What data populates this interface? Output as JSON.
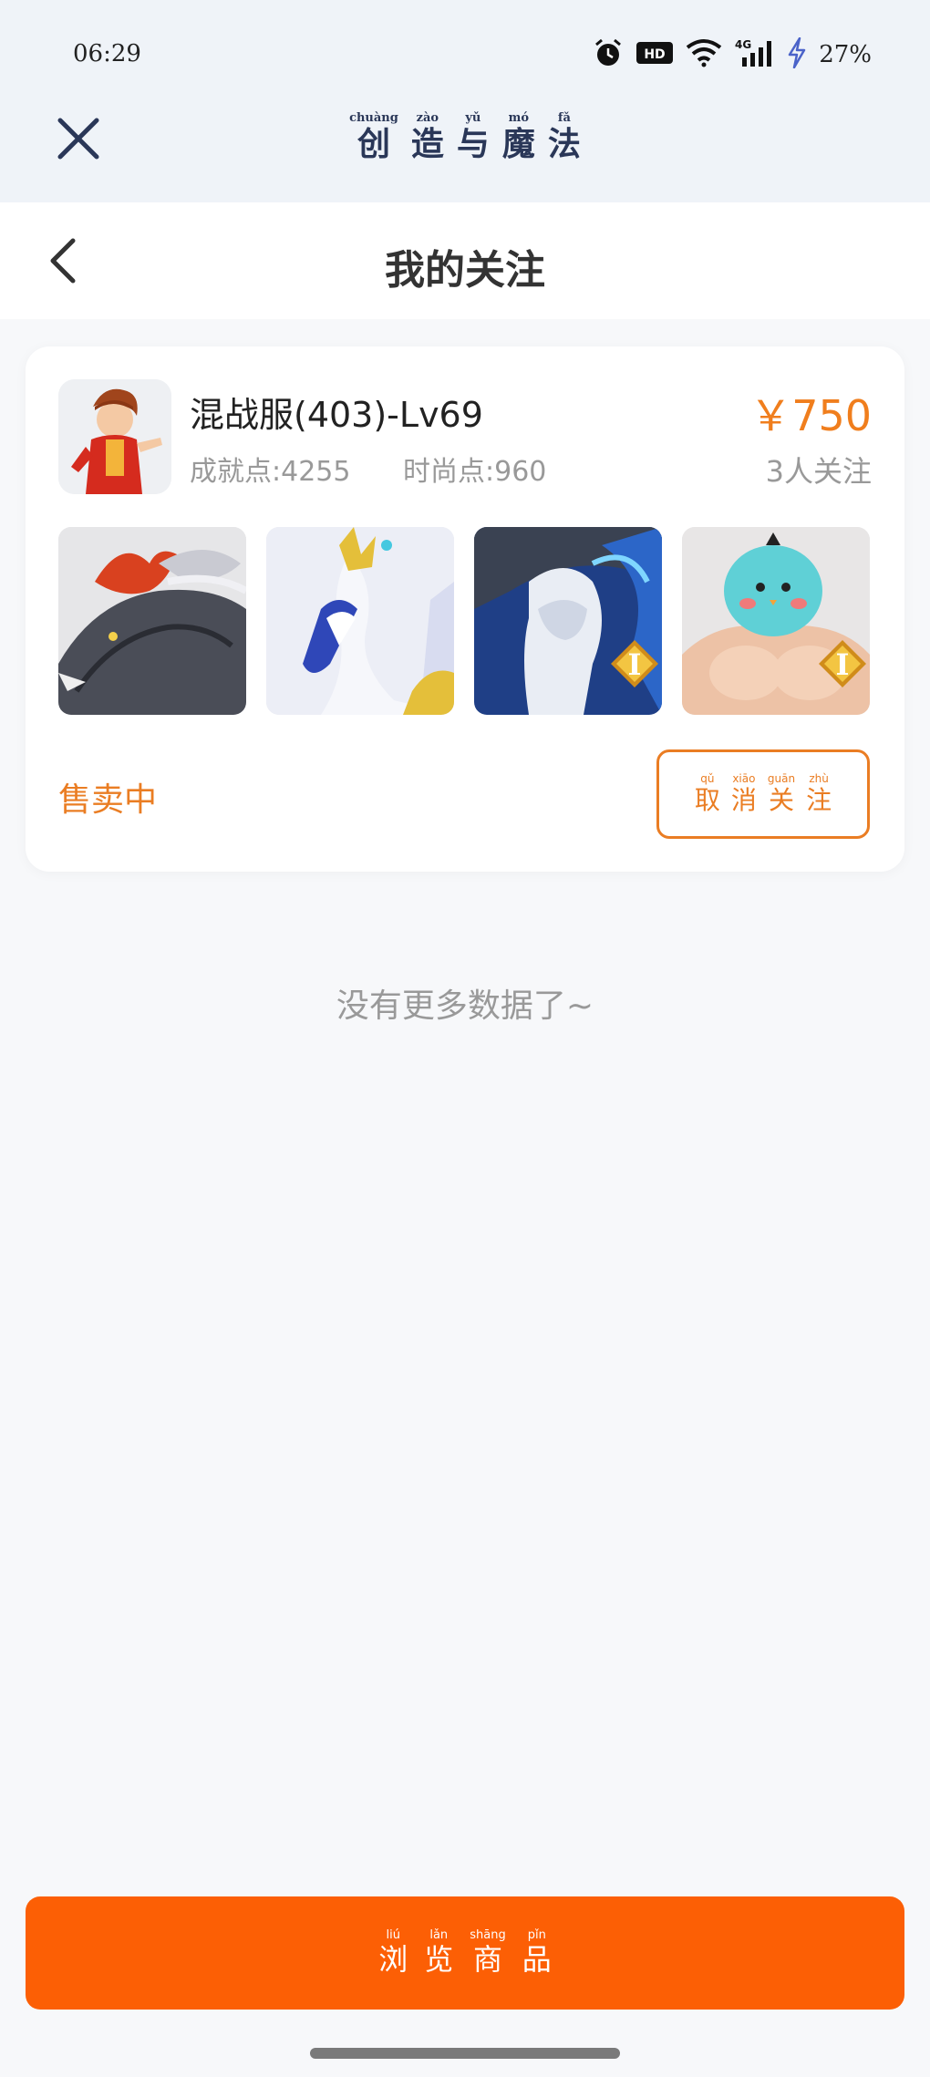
{
  "status_bar": {
    "time": "06:29",
    "battery": "27%",
    "icons": [
      "alarm-icon",
      "hd-icon",
      "wifi-icon",
      "signal-4g-icon",
      "charging-icon"
    ]
  },
  "app_bar": {
    "title_chars": [
      {
        "py": "chuàng",
        "hz": "创"
      },
      {
        "py": "zào",
        "hz": "造"
      },
      {
        "py": "yǔ",
        "hz": "与"
      },
      {
        "py": "mó",
        "hz": "魔"
      },
      {
        "py": "fǎ",
        "hz": "法"
      }
    ]
  },
  "nav": {
    "title": "我的关注"
  },
  "listing": {
    "server_name": "混战服(403)-Lv69",
    "achievement": "成就点:4255",
    "fashion": "时尚点:960",
    "price": "￥750",
    "followers": "3人关注",
    "status": "售卖中",
    "thumb_badge": "I",
    "unfollow_chars": [
      {
        "py": "qǔ",
        "hz": "取"
      },
      {
        "py": "xiāo",
        "hz": "消"
      },
      {
        "py": "guān",
        "hz": "关"
      },
      {
        "py": "zhù",
        "hz": "注"
      }
    ]
  },
  "empty_text": "没有更多数据了~",
  "browse_chars": [
    {
      "py": "liú",
      "hz": "浏"
    },
    {
      "py": "lǎn",
      "hz": "览"
    },
    {
      "py": "shāng",
      "hz": "商"
    },
    {
      "py": "pǐn",
      "hz": "品"
    }
  ],
  "colors": {
    "accent": "#ea7d23",
    "price": "#f07e1d",
    "primary_button": "#fc5f05",
    "title_navy": "#2a3758"
  }
}
